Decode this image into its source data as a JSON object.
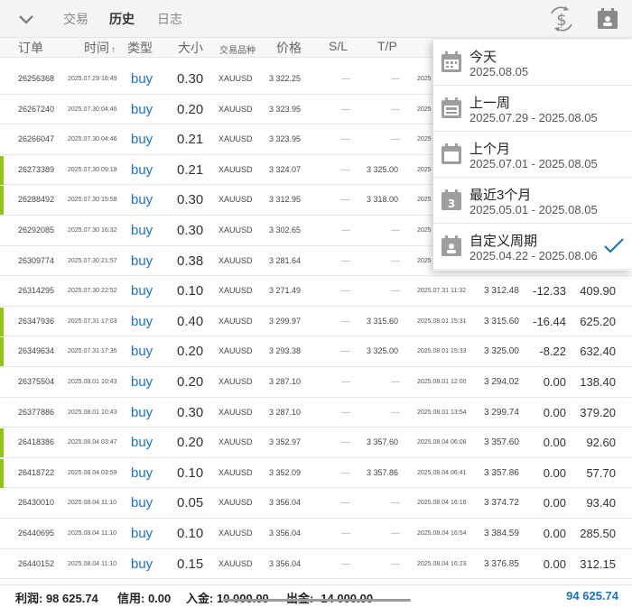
{
  "tabs": [
    {
      "label": "交易"
    },
    {
      "label": "历史"
    },
    {
      "label": "日志"
    }
  ],
  "active_tab": "历史",
  "toolbar_icons": [
    "chevron-down-icon",
    "currency-swap-icon",
    "calendar-icon"
  ],
  "columns": {
    "order": "订单",
    "time": "时间",
    "type": "类型",
    "size": "大小",
    "symbol": "交易品种",
    "price": "价格",
    "sl": "S/L",
    "tp": "T/P"
  },
  "sort_indicator": "↑",
  "rows": [
    {
      "id": "26256368",
      "time": "2025.07.29 18:49",
      "type": "buy",
      "size": "0.30",
      "symbol": "XAUUSD",
      "price": "3 322.25",
      "sl": "—",
      "tp": "—",
      "close_time": "2025",
      "close_price": "",
      "swap": "",
      "profit": "",
      "flag": false
    },
    {
      "id": "26267240",
      "time": "2025.07.30 04:46",
      "type": "buy",
      "size": "0.20",
      "symbol": "XAUUSD",
      "price": "3 323.95",
      "sl": "—",
      "tp": "—",
      "close_time": "2025",
      "close_price": "",
      "swap": "",
      "profit": "",
      "flag": false
    },
    {
      "id": "26266047",
      "time": "2025.07.30 04:46",
      "type": "buy",
      "size": "0.21",
      "symbol": "XAUUSD",
      "price": "3 323.95",
      "sl": "—",
      "tp": "—",
      "close_time": "2025",
      "close_price": "",
      "swap": "",
      "profit": "",
      "flag": false
    },
    {
      "id": "26273389",
      "time": "2025.07.30 09:19",
      "type": "buy",
      "size": "0.21",
      "symbol": "XAUUSD",
      "price": "3 324.07",
      "sl": "—",
      "tp": "3 325.00",
      "close_time": "2025",
      "close_price": "",
      "swap": "",
      "profit": "",
      "flag": true
    },
    {
      "id": "26288492",
      "time": "2025.07.30 15:58",
      "type": "buy",
      "size": "0.30",
      "symbol": "XAUUSD",
      "price": "3 312.95",
      "sl": "—",
      "tp": "3 318.00",
      "close_time": "2025",
      "close_price": "",
      "swap": "",
      "profit": "",
      "flag": true
    },
    {
      "id": "26292085",
      "time": "2025.07.30 16:32",
      "type": "buy",
      "size": "0.30",
      "symbol": "XAUUSD",
      "price": "3 302.65",
      "sl": "—",
      "tp": "—",
      "close_time": "2025",
      "close_price": "",
      "swap": "",
      "profit": "",
      "flag": false
    },
    {
      "id": "26309774",
      "time": "2025.07.30 21:57",
      "type": "buy",
      "size": "0.38",
      "symbol": "XAUUSD",
      "price": "3 281.64",
      "sl": "—",
      "tp": "—",
      "close_time": "2025",
      "close_price": "",
      "swap": "",
      "profit": "",
      "flag": false
    },
    {
      "id": "26314295",
      "time": "2025.07.30 22:52",
      "type": "buy",
      "size": "0.10",
      "symbol": "XAUUSD",
      "price": "3 271.49",
      "sl": "—",
      "tp": "—",
      "close_time": "2025.07.31 11:32",
      "close_price": "3 312.48",
      "swap": "-12.33",
      "profit": "409.90",
      "flag": false
    },
    {
      "id": "26347936",
      "time": "2025.07.31 17:03",
      "type": "buy",
      "size": "0.40",
      "symbol": "XAUUSD",
      "price": "3 299.97",
      "sl": "—",
      "tp": "3 315.60",
      "close_time": "2025.08.01 15:31",
      "close_price": "3 315.60",
      "swap": "-16.44",
      "profit": "625.20",
      "flag": true
    },
    {
      "id": "26349634",
      "time": "2025.07.31 17:35",
      "type": "buy",
      "size": "0.20",
      "symbol": "XAUUSD",
      "price": "3 293.38",
      "sl": "—",
      "tp": "3 325.00",
      "close_time": "2025.08.01 15:33",
      "close_price": "3 325.00",
      "swap": "-8.22",
      "profit": "632.40",
      "flag": true
    },
    {
      "id": "26375504",
      "time": "2025.08.01 10:43",
      "type": "buy",
      "size": "0.20",
      "symbol": "XAUUSD",
      "price": "3 287.10",
      "sl": "—",
      "tp": "—",
      "close_time": "2025.08.01 12:00",
      "close_price": "3 294.02",
      "swap": "0.00",
      "profit": "138.40",
      "flag": false
    },
    {
      "id": "26377886",
      "time": "2025.08.01 10:43",
      "type": "buy",
      "size": "0.30",
      "symbol": "XAUUSD",
      "price": "3 287.10",
      "sl": "—",
      "tp": "—",
      "close_time": "2025.08.01 13:54",
      "close_price": "3 299.74",
      "swap": "0.00",
      "profit": "379.20",
      "flag": false
    },
    {
      "id": "26418386",
      "time": "2025.08.04 03:47",
      "type": "buy",
      "size": "0.20",
      "symbol": "XAUUSD",
      "price": "3 352.97",
      "sl": "—",
      "tp": "3 357.60",
      "close_time": "2025.08.04 06:08",
      "close_price": "3 357.60",
      "swap": "0.00",
      "profit": "92.60",
      "flag": true
    },
    {
      "id": "26418722",
      "time": "2025.08.04 03:59",
      "type": "buy",
      "size": "0.10",
      "symbol": "XAUUSD",
      "price": "3 352.09",
      "sl": "—",
      "tp": "3 357.86",
      "close_time": "2025.08.04 06:41",
      "close_price": "3 357.86",
      "swap": "0.00",
      "profit": "57.70",
      "flag": true
    },
    {
      "id": "26430010",
      "time": "2025.08.04 11:10",
      "type": "buy",
      "size": "0.05",
      "symbol": "XAUUSD",
      "price": "3 356.04",
      "sl": "—",
      "tp": "—",
      "close_time": "2025.08.04 16:16",
      "close_price": "3 374.72",
      "swap": "0.00",
      "profit": "93.40",
      "flag": false
    },
    {
      "id": "26440695",
      "time": "2025.08.04 11:10",
      "type": "buy",
      "size": "0.10",
      "symbol": "XAUUSD",
      "price": "3 356.04",
      "sl": "—",
      "tp": "—",
      "close_time": "2025.08.04 16:54",
      "close_price": "3 384.59",
      "swap": "0.00",
      "profit": "285.50",
      "flag": false
    },
    {
      "id": "26440152",
      "time": "2025.08.04 11:10",
      "type": "buy",
      "size": "0.15",
      "symbol": "XAUUSD",
      "price": "3 356.04",
      "sl": "—",
      "tp": "—",
      "close_time": "2025.08.04 16:23",
      "close_price": "3 376.85",
      "swap": "0.00",
      "profit": "312.15",
      "flag": false
    }
  ],
  "footer": {
    "profit": "利润: 98 625.74",
    "credit": "信用: 0.00",
    "deposit": "入金: 10 000.00",
    "withdrawal": "出金: -14 000.00",
    "total": "94 625.74"
  },
  "period_menu": [
    {
      "title": "今天",
      "range": "2025.08.05",
      "icon": "calendar-day-icon",
      "selected": false
    },
    {
      "title": "上一周",
      "range": "2025.07.29 - 2025.08.05",
      "icon": "calendar-week-icon",
      "selected": false
    },
    {
      "title": "上个月",
      "range": "2025.07.01 - 2025.08.05",
      "icon": "calendar-month-icon",
      "selected": false
    },
    {
      "title": "最近3个月",
      "range": "2025.05.01 - 2025.08.05",
      "icon": "calendar-3-icon",
      "selected": false
    },
    {
      "title": "自定义周期",
      "range": "2025.04.22 - 2025.08.06",
      "icon": "calendar-custom-icon",
      "selected": true
    }
  ],
  "colors": {
    "accent_blue": "#1a73c8",
    "flag_green": "#8fc11f",
    "icon_gray": "#9e9e9e"
  }
}
